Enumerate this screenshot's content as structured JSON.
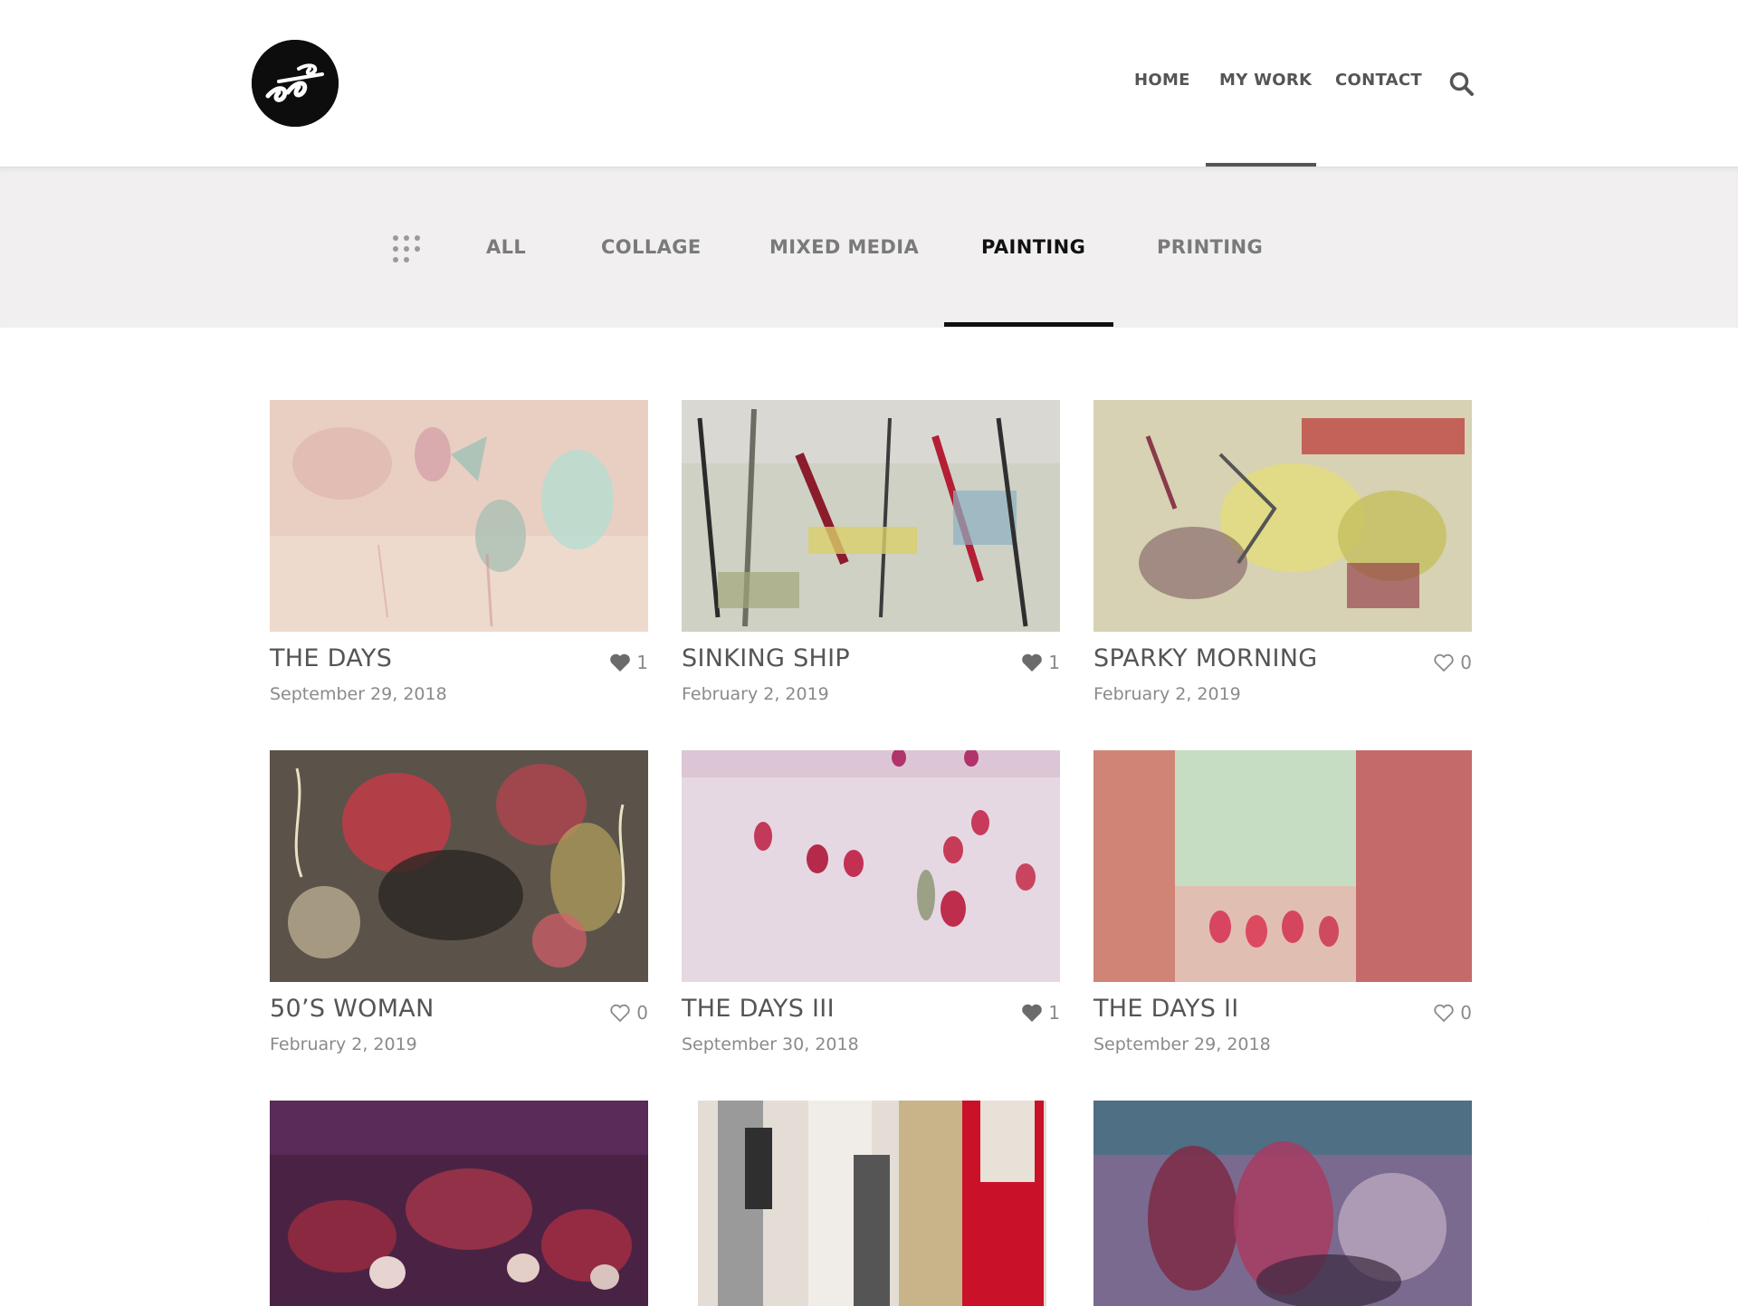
{
  "header": {
    "logo_icon": "artist-logo-icon",
    "nav": [
      {
        "label": "HOME"
      },
      {
        "label": "MY WORK",
        "active": true
      },
      {
        "label": "CONTACT"
      }
    ],
    "search_icon": "search-icon"
  },
  "filters": {
    "grid_icon": "grid-dots-icon",
    "items": [
      {
        "label": "ALL"
      },
      {
        "label": "COLLAGE"
      },
      {
        "label": "MIXED MEDIA"
      },
      {
        "label": "PAINTING",
        "active": true
      },
      {
        "label": "PRINTING"
      }
    ]
  },
  "works": [
    {
      "title": "THE DAYS",
      "date": "September 29, 2018",
      "likes": "1",
      "liked": true
    },
    {
      "title": "SINKING SHIP",
      "date": "February 2, 2019",
      "likes": "1",
      "liked": true
    },
    {
      "title": "SPARKY MORNING",
      "date": "February 2, 2019",
      "likes": "0",
      "liked": false
    },
    {
      "title": "50’S WOMAN",
      "date": "February 2, 2019",
      "likes": "0",
      "liked": false
    },
    {
      "title": "THE DAYS III",
      "date": "September 30, 2018",
      "likes": "1",
      "liked": true
    },
    {
      "title": "THE DAYS II",
      "date": "September 29, 2018",
      "likes": "0",
      "liked": false
    },
    {
      "title": "",
      "date": "",
      "likes": "",
      "liked": false
    },
    {
      "title": "",
      "date": "",
      "likes": "",
      "liked": false
    },
    {
      "title": "",
      "date": "",
      "likes": "",
      "liked": false
    }
  ],
  "colors": {
    "heart_filled": "#6b6b6b",
    "heart_outline": "#8a8a8a",
    "active_text": "#111111",
    "filter_bg": "#f1efef"
  }
}
